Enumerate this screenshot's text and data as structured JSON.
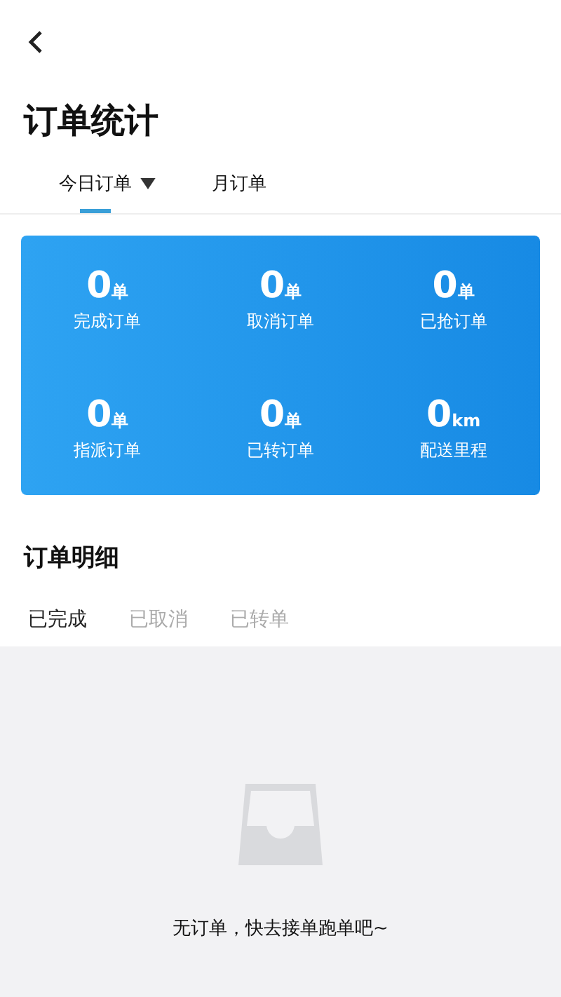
{
  "page": {
    "title": "订单统计"
  },
  "tabs": [
    {
      "label": "今日订单",
      "selected": true,
      "dropdown": true
    },
    {
      "label": "月订单",
      "selected": false,
      "dropdown": false
    }
  ],
  "stats": [
    {
      "value": "0",
      "unit": "单",
      "label": "完成订单"
    },
    {
      "value": "0",
      "unit": "单",
      "label": "取消订单"
    },
    {
      "value": "0",
      "unit": "单",
      "label": "已抢订单"
    },
    {
      "value": "0",
      "unit": "单",
      "label": "指派订单"
    },
    {
      "value": "0",
      "unit": "单",
      "label": "已转订单"
    },
    {
      "value": "0",
      "unit": "km",
      "label": "配送里程"
    }
  ],
  "detail": {
    "title": "订单明细",
    "filters": [
      {
        "label": "已完成",
        "selected": true
      },
      {
        "label": "已取消",
        "selected": false
      },
      {
        "label": "已转单",
        "selected": false
      }
    ],
    "empty_message": "无订单，快去接单跑单吧~"
  }
}
